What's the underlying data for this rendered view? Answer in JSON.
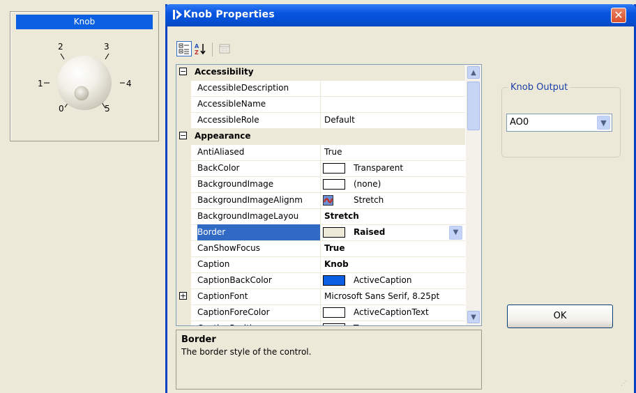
{
  "knob_control": {
    "caption": "Knob",
    "tick_labels": [
      "0",
      "1",
      "2",
      "3",
      "4",
      "5"
    ]
  },
  "dialog": {
    "title": "Knob Properties",
    "close_glyph": "✕",
    "toolbar": {
      "categorized_icon": "categorized-icon",
      "alphabetical_icon": "alphabetical-sort-icon",
      "property_pages_icon": "property-pages-icon"
    },
    "property_grid": {
      "rows": [
        {
          "type": "category",
          "name": "Accessibility",
          "expanded": true
        },
        {
          "type": "prop",
          "name": "AccessibleDescription",
          "value": ""
        },
        {
          "type": "prop",
          "name": "AccessibleName",
          "value": ""
        },
        {
          "type": "prop",
          "name": "AccessibleRole",
          "value": "Default"
        },
        {
          "type": "category",
          "name": "Appearance",
          "expanded": true
        },
        {
          "type": "prop",
          "name": "AntiAliased",
          "value": "True"
        },
        {
          "type": "prop",
          "name": "BackColor",
          "value": "Transparent",
          "swatch": "#ffffff"
        },
        {
          "type": "prop",
          "name": "BackgroundImage",
          "value": "(none)",
          "swatch": "#ffffff"
        },
        {
          "type": "prop",
          "name": "BackgroundImageAlignm",
          "value": "Stretch",
          "image_icon": "image-icon"
        },
        {
          "type": "prop",
          "name": "BackgroundImageLayou",
          "value": "Stretch",
          "bold": true
        },
        {
          "type": "prop",
          "name": "Border",
          "value": "Raised",
          "bold": true,
          "selected": true,
          "swatch": "#ece9d8"
        },
        {
          "type": "prop",
          "name": "CanShowFocus",
          "value": "True",
          "bold": true
        },
        {
          "type": "prop",
          "name": "Caption",
          "value": "Knob",
          "bold": true
        },
        {
          "type": "prop",
          "name": "CaptionBackColor",
          "value": "ActiveCaption",
          "swatch": "#0a5fe3"
        },
        {
          "type": "prop",
          "name": "CaptionFont",
          "value": "Microsoft Sans Serif, 8.25pt",
          "expandable": true
        },
        {
          "type": "prop",
          "name": "CaptionForeColor",
          "value": "ActiveCaptionText",
          "swatch": "#ffffff"
        },
        {
          "type": "prop",
          "name": "CaptionPosition",
          "value": "Top",
          "swatch": "#0a5fe3"
        }
      ]
    },
    "description": {
      "title": "Border",
      "text": "The border style of the control."
    },
    "knob_output": {
      "label": "Knob Output",
      "selected": "AO0"
    },
    "ok_label": "OK"
  },
  "colors": {
    "window_bg": "#ece9d8",
    "title_blue": "#0a55e0",
    "selection": "#316ac5",
    "caption_blue": "#0a5fe3"
  }
}
